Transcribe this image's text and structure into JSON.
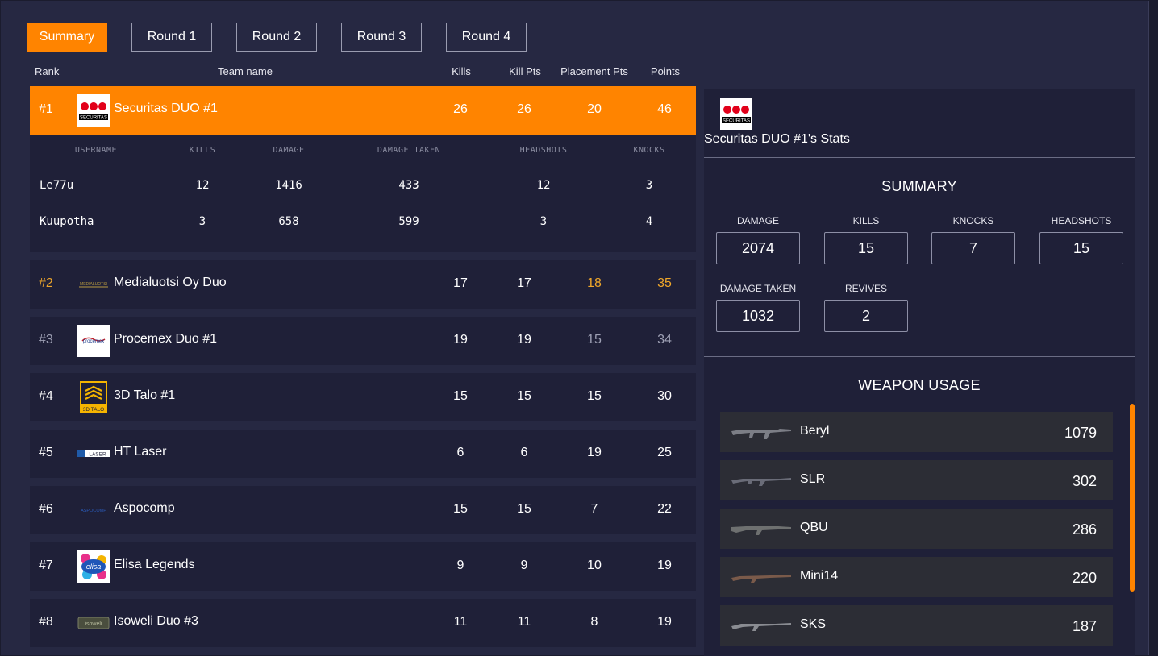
{
  "tabs": [
    {
      "label": "Summary",
      "active": true
    },
    {
      "label": "Round 1",
      "active": false
    },
    {
      "label": "Round 2",
      "active": false
    },
    {
      "label": "Round 3",
      "active": false
    },
    {
      "label": "Round 4",
      "active": false
    }
  ],
  "columns": {
    "rank": "Rank",
    "team_name": "Team name",
    "kills": "Kills",
    "kill_pts": "Kill Pts",
    "placement_pts": "Placement Pts",
    "points": "Points"
  },
  "teams": [
    {
      "rank": "#1",
      "name": "Securitas DUO #1",
      "kills": "26",
      "kill_pts": "26",
      "placement_pts": "20",
      "points": "46",
      "logo": "securitas-logo"
    },
    {
      "rank": "#2",
      "name": "Medialuotsi Oy Duo",
      "kills": "17",
      "kill_pts": "17",
      "placement_pts": "18",
      "points": "35",
      "logo": "medialuotsi-logo"
    },
    {
      "rank": "#3",
      "name": "Procemex Duo #1",
      "kills": "19",
      "kill_pts": "19",
      "placement_pts": "15",
      "points": "34",
      "logo": "procemex-logo"
    },
    {
      "rank": "#4",
      "name": "3D Talo #1",
      "kills": "15",
      "kill_pts": "15",
      "placement_pts": "15",
      "points": "30",
      "logo": "3dtalo-logo"
    },
    {
      "rank": "#5",
      "name": "HT Laser",
      "kills": "6",
      "kill_pts": "6",
      "placement_pts": "19",
      "points": "25",
      "logo": "htlaser-logo"
    },
    {
      "rank": "#6",
      "name": "Aspocomp",
      "kills": "15",
      "kill_pts": "15",
      "placement_pts": "7",
      "points": "22",
      "logo": "aspocomp-logo"
    },
    {
      "rank": "#7",
      "name": "Elisa Legends",
      "kills": "9",
      "kill_pts": "9",
      "placement_pts": "10",
      "points": "19",
      "logo": "elisa-logo"
    },
    {
      "rank": "#8",
      "name": "Isoweli Duo #3",
      "kills": "11",
      "kill_pts": "11",
      "placement_pts": "8",
      "points": "19",
      "logo": "isoweli-logo"
    }
  ],
  "player_table": {
    "headers": {
      "username": "USERNAME",
      "kills": "KILLS",
      "damage": "DAMAGE",
      "damage_taken": "DAMAGE TAKEN",
      "headshots": "HEADSHOTS",
      "knocks": "KNOCKS"
    },
    "players": [
      {
        "username": "Le77u",
        "kills": "12",
        "damage": "1416",
        "damage_taken": "433",
        "headshots": "12",
        "knocks": "3"
      },
      {
        "username": "Kuupotha",
        "kills": "3",
        "damage": "658",
        "damage_taken": "599",
        "headshots": "3",
        "knocks": "4"
      }
    ]
  },
  "stats_panel": {
    "logo_text": "SECURITAS",
    "title": "Securitas DUO #1's Stats",
    "summary_title": "SUMMARY",
    "stats": [
      {
        "label": "DAMAGE",
        "value": "2074"
      },
      {
        "label": "KILLS",
        "value": "15"
      },
      {
        "label": "KNOCKS",
        "value": "7"
      },
      {
        "label": "HEADSHOTS",
        "value": "15"
      },
      {
        "label": "DAMAGE TAKEN",
        "value": "1032"
      },
      {
        "label": "REVIVES",
        "value": "2"
      }
    ],
    "weapon_title": "WEAPON USAGE",
    "weapons": [
      {
        "name": "Beryl",
        "value": "1079",
        "icon": "rifle-icon"
      },
      {
        "name": "SLR",
        "value": "302",
        "icon": "rifle-icon"
      },
      {
        "name": "QBU",
        "value": "286",
        "icon": "rifle-icon"
      },
      {
        "name": "Mini14",
        "value": "220",
        "icon": "rifle-icon"
      },
      {
        "name": "SKS",
        "value": "187",
        "icon": "rifle-icon"
      }
    ]
  },
  "logo_texts": {
    "medialuotsi": "MEDIALUOTSI",
    "procemex": "procemex",
    "talo": "3D TALO",
    "htlaser": "LASER",
    "aspocomp": "ASPOCOMP",
    "elisa": "elisa",
    "isoweli": "isoweli"
  },
  "colors": {
    "accent": "#ff8400",
    "background": "#262842",
    "row": "#1f2038",
    "gold_text": "#f0a72a"
  }
}
